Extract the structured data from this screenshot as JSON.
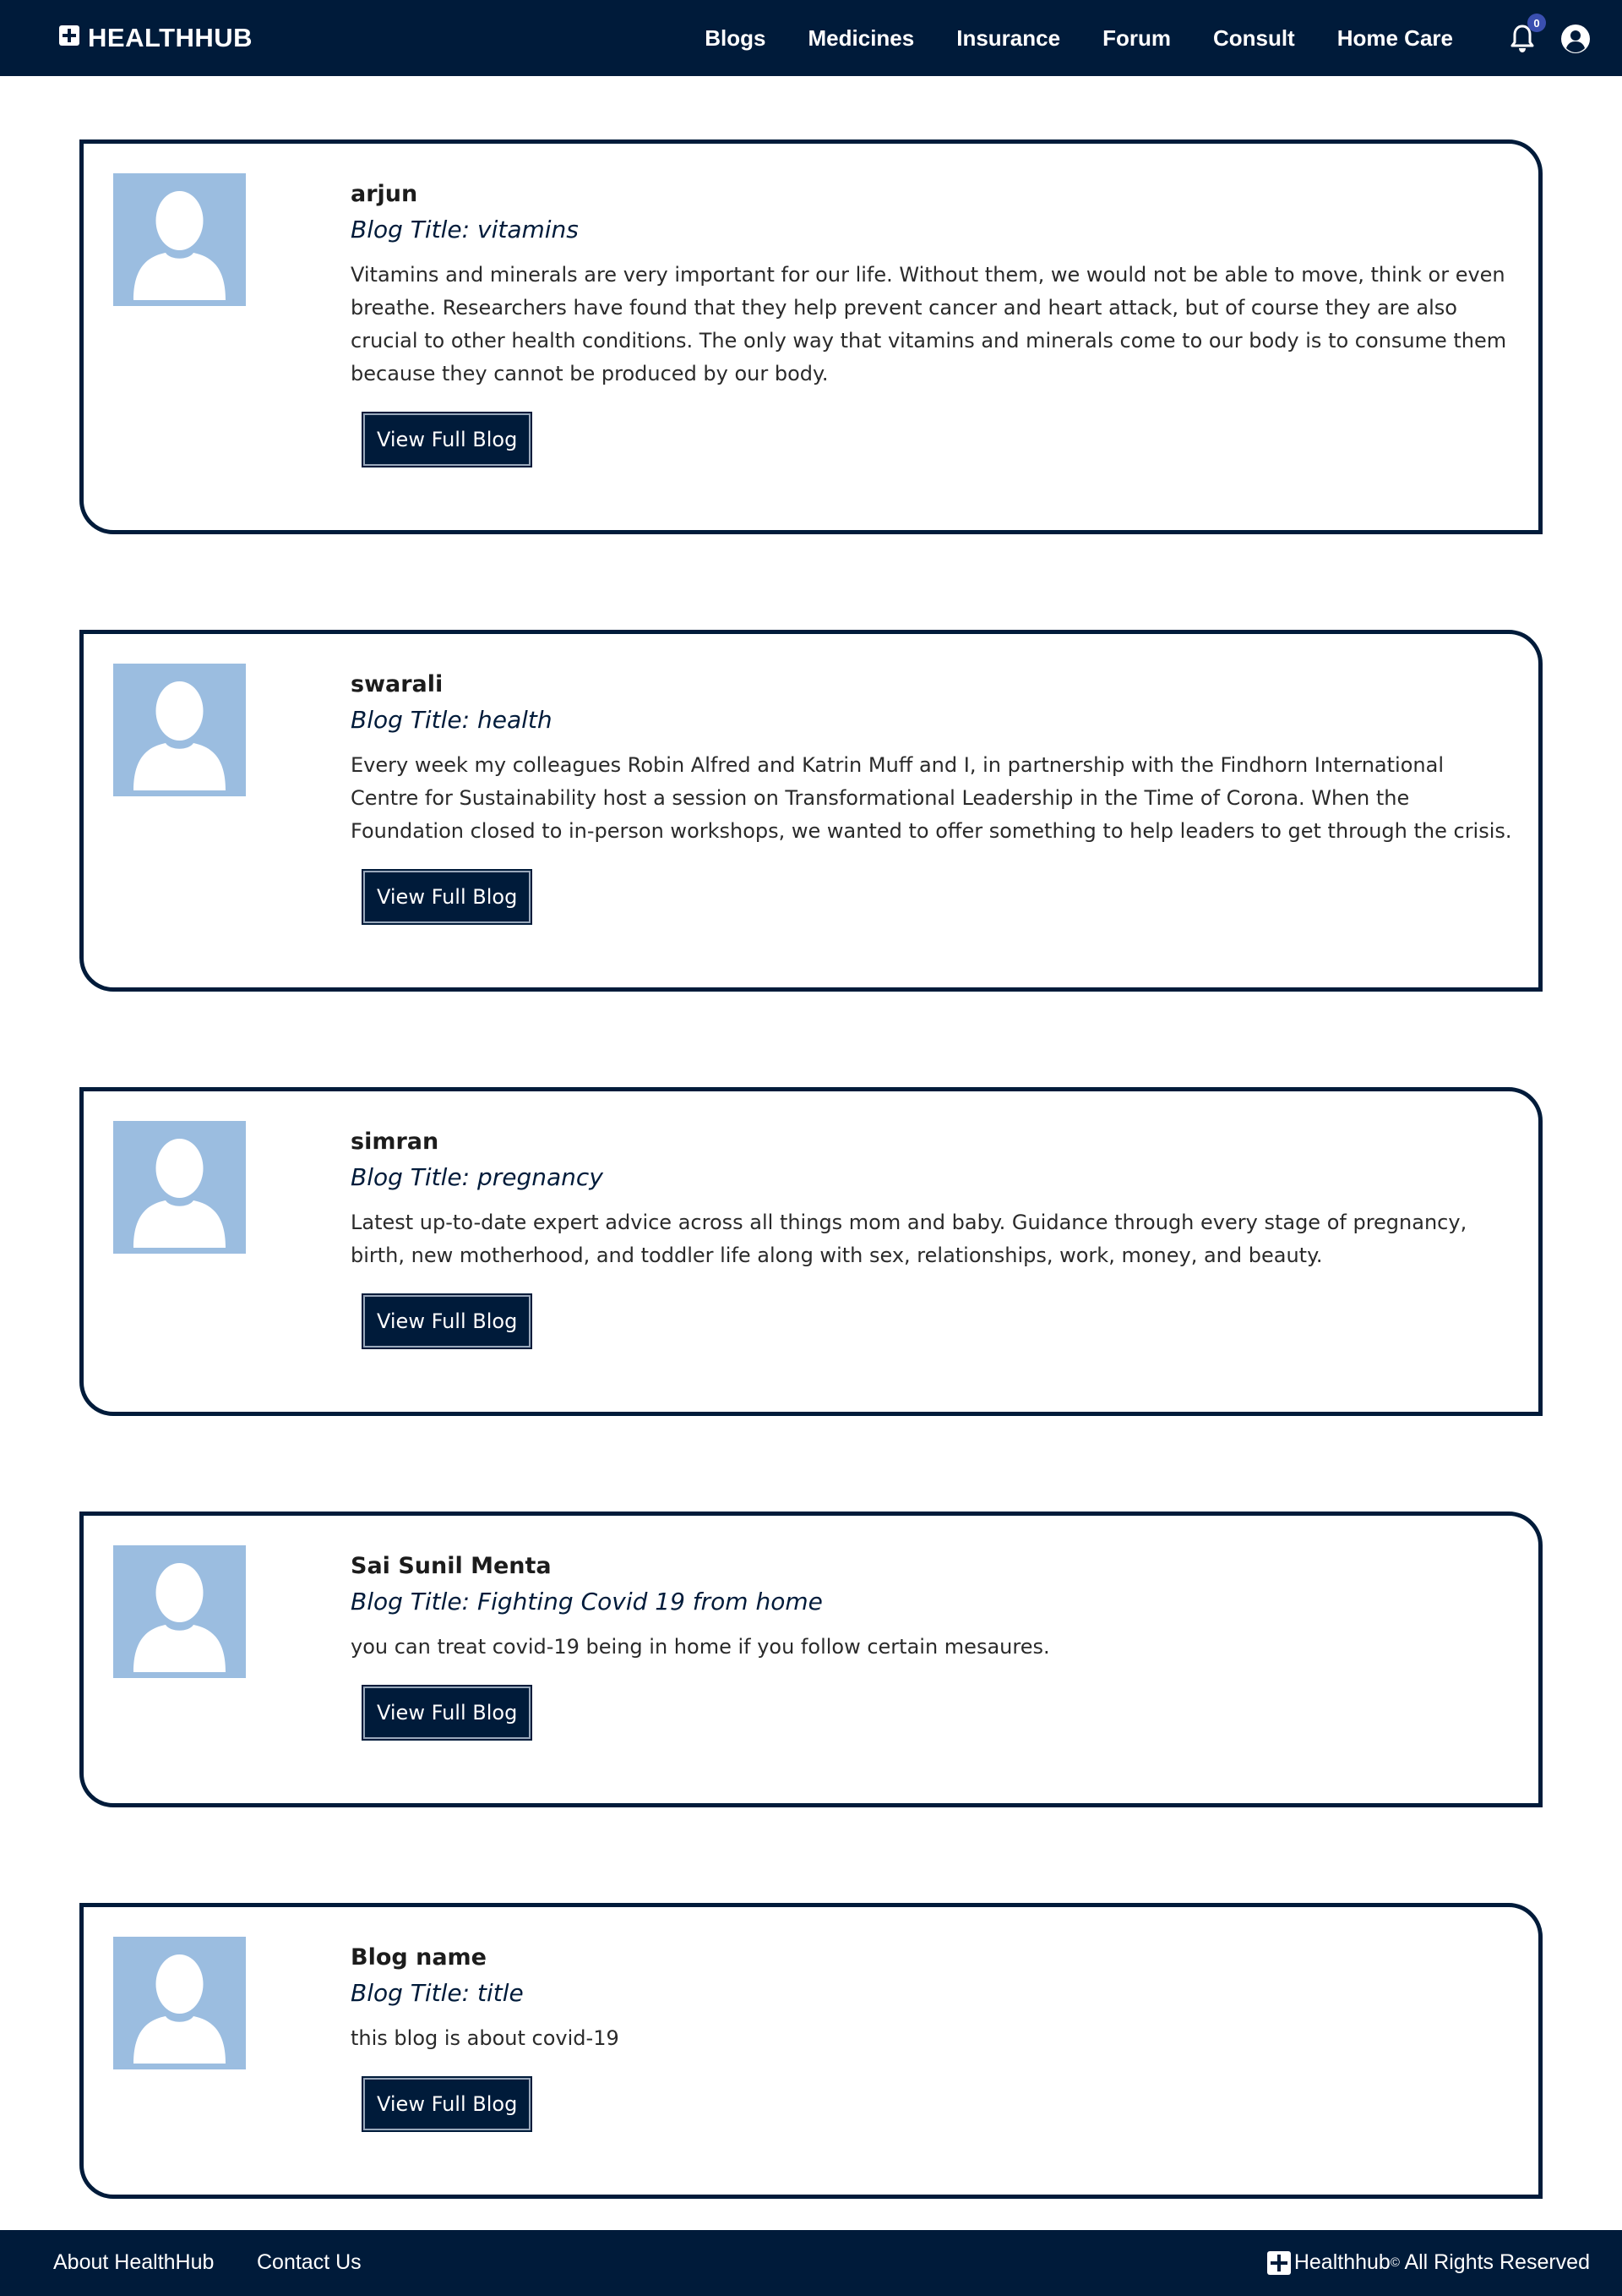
{
  "nav": {
    "brand": "HEALTHHUB",
    "links": [
      "Blogs",
      "Medicines",
      "Insurance",
      "Forum",
      "Consult",
      "Home Care"
    ],
    "notification_count": "0",
    "icons": [
      "plus-logo-icon",
      "bell-icon",
      "user-circle-icon"
    ]
  },
  "blogs": [
    {
      "author": "arjun",
      "title": "Blog Title: vitamins",
      "excerpt": "Vitamins and minerals are very important for our life. Without them, we would not be able to move, think or even breathe. Researchers have found that they help prevent cancer and heart attack, but of course they are also crucial to other health conditions. The only way that vitamins and minerals come to our body is to consume them because they cannot be produced by our body.",
      "button": "View Full Blog"
    },
    {
      "author": "swarali",
      "title": "Blog Title: health",
      "excerpt": "Every week my colleagues Robin Alfred and Katrin Muff and I, in partnership with the Findhorn International Centre for Sustainability host a session on Transformational Leadership in the Time of Corona. When the Foundation closed to in-person workshops, we wanted to offer something to help leaders to get through the crisis.",
      "button": "View Full Blog"
    },
    {
      "author": "simran",
      "title": "Blog Title: pregnancy",
      "excerpt": "Latest up-to-date expert advice across all things mom and baby. Guidance through every stage of pregnancy, birth, new motherhood, and toddler life along with sex, relationships, work, money, and beauty.",
      "button": "View Full Blog"
    },
    {
      "author": "Sai Sunil Menta",
      "title": "Blog Title: Fighting Covid 19 from home",
      "excerpt": "you can treat covid-19 being in home if you follow certain mesaures.",
      "button": "View Full Blog"
    },
    {
      "author": "Blog name",
      "title": "Blog Title: title",
      "excerpt": "this blog is about covid-19",
      "button": "View Full Blog"
    }
  ],
  "footer": {
    "about": "About HealthHub",
    "contact": "Contact Us",
    "copyright_brand": "Healthhub",
    "copyright_mark": "©",
    "copyright_text": " All Rights Reserved"
  },
  "colors": {
    "navy": "#001b3a",
    "avatar_bg": "#9bbde0",
    "badge": "#3a4fb0"
  }
}
